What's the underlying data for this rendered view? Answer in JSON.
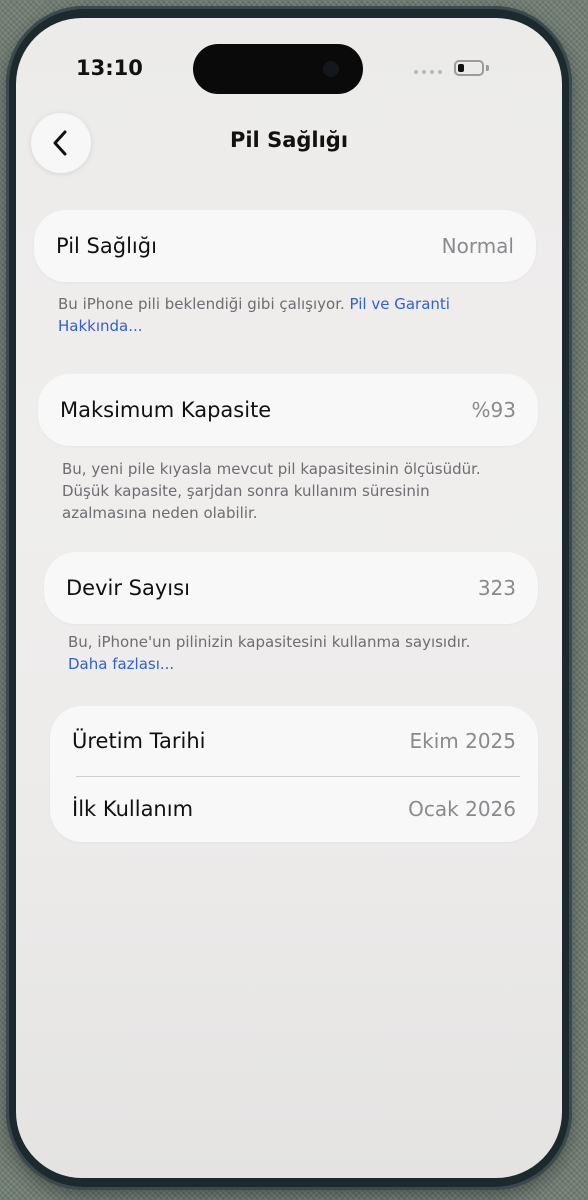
{
  "status_bar": {
    "time": "13:10",
    "battery_level": 0.2
  },
  "nav": {
    "back_icon": "chevron-left-icon",
    "title": "Pil Sağlığı"
  },
  "battery_health": {
    "label": "Pil Sağlığı",
    "value": "Normal",
    "footnote": "Bu iPhone pili beklendiği gibi çalışıyor.",
    "link_part1": "Pil ve Garanti",
    "link_part2": "Hakkında..."
  },
  "max_capacity": {
    "label": "Maksimum Kapasite",
    "value": "%93",
    "footnote_line1": "Bu, yeni pile kıyasla mevcut pil kapasitesinin ölçüsüdür.",
    "footnote_line2": "Düşük kapasite, şarjdan sonra kullanım süresinin",
    "footnote_line3": "azalmasına neden olabilir."
  },
  "cycle_count": {
    "label": "Devir Sayısı",
    "value": "323",
    "footnote": "Bu, iPhone'un pilinizin kapasitesini kullanma sayısıdır.",
    "link": "Daha fazlası..."
  },
  "dates": {
    "manufacture_label": "Üretim Tarihi",
    "manufacture_value": "Ekim 2025",
    "first_use_label": "İlk Kullanım",
    "first_use_value": "Ocak 2026"
  }
}
